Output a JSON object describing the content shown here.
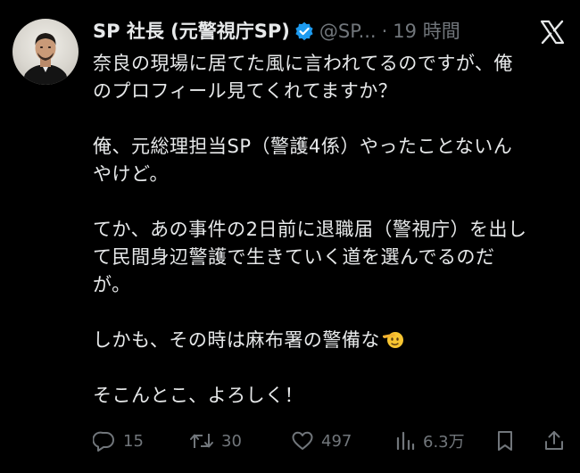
{
  "author": {
    "display_name": "SP 社長 (元警視庁SP)",
    "handle": "@SP...",
    "separator": "·",
    "time": "19 時間",
    "verified_color": "#1d9bf0"
  },
  "platform_icon": "x-logo-icon",
  "body": {
    "paragraphs": [
      [
        "奈良の現場に居てた風に言われてるのですが、俺",
        "のプロフィール見てくれてますか？"
      ],
      [
        "俺、元総理担当SP（警護4係）やったことないん",
        "やけど。"
      ],
      [
        "てか、あの事件の2日前に退職届（警視庁）を出し",
        "て民間身辺警護で生きていく道を選んでるのだ",
        "が。"
      ],
      [
        "しかも、その時は麻布署の警備な"
      ],
      [
        "そこんとこ、よろしく！"
      ]
    ],
    "emoji": "saluting-face-emoji"
  },
  "actions": {
    "reply_count": "15",
    "retweet_count": "30",
    "like_count": "497",
    "view_count": "6.3万"
  },
  "colors": {
    "background": "#000000",
    "text": "#e7e9ea",
    "muted": "#71767b",
    "accent": "#1d9bf0"
  }
}
